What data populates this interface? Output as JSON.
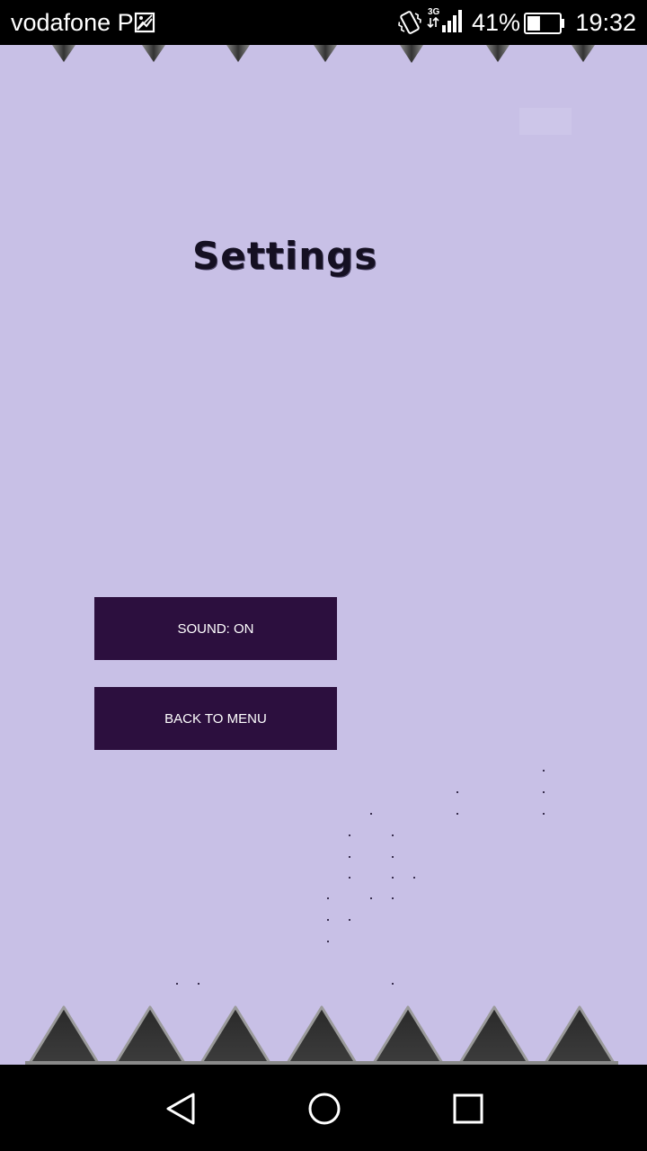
{
  "status_bar": {
    "carrier": "vodafone P",
    "network_type": "3G",
    "battery_percent": "41%",
    "battery_level": 0.41,
    "time": "19:32",
    "icons": [
      "gallery-icon",
      "vibrate-icon",
      "signal-icon",
      "battery-icon"
    ]
  },
  "screen": {
    "title": "Settings",
    "background_color": "#c8c0e6",
    "button_color": "#2c0f3e",
    "buttons": [
      {
        "label": "SOUND: ON"
      },
      {
        "label": "BACK TO MENU"
      }
    ]
  },
  "nav_bar": {
    "icons": [
      "back-icon",
      "home-icon",
      "recent-apps-icon"
    ]
  }
}
